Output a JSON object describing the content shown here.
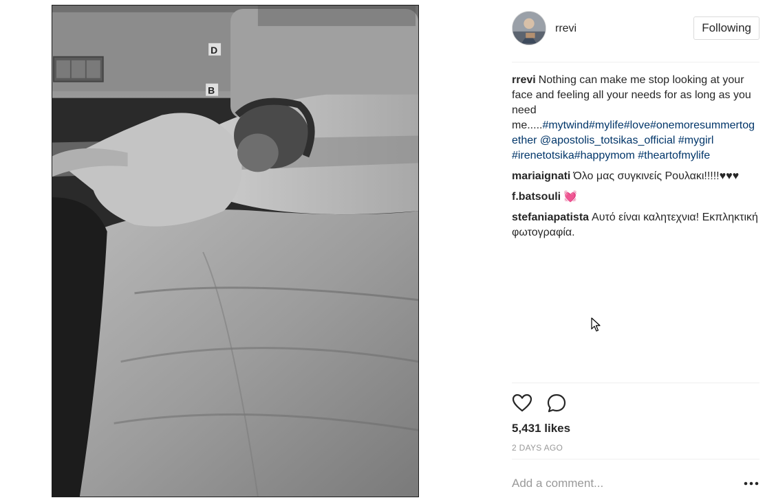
{
  "post": {
    "username": "rrevi",
    "follow_label": "Following",
    "caption": {
      "user": "rrevi",
      "text_plain": "Nothing can make me stop looking at your face and feeling all your needs for as long as you need me.....",
      "tags": [
        "#mytwind",
        "#mylife",
        "#love",
        "#onemoresummertogether",
        "@apostolis_totsikas_official",
        "#mygirl",
        "#irenetotsika",
        "#happymom",
        "#theartofmylife"
      ]
    },
    "comments": [
      {
        "user": "mariaignati",
        "text": "Όλο μας συγκινείς Ρουλακι!!!!!♥♥♥"
      },
      {
        "user": "f.batsouli",
        "text": "💓"
      },
      {
        "user": "stefaniapatista",
        "text": "Αυτό είναι καλητεχνια! Εκπληκτική φωτογραφία."
      }
    ],
    "likes": "5,431 likes",
    "timestamp": "2 DAYS AGO",
    "comment_placeholder": "Add a comment...",
    "icons": {
      "like": "heart-icon",
      "comment": "comment-bubble-icon",
      "more": "more-options-icon"
    },
    "colors": {
      "hashtag": "#003569",
      "text": "#262626",
      "muted": "#999999",
      "divider": "#efefef"
    }
  }
}
